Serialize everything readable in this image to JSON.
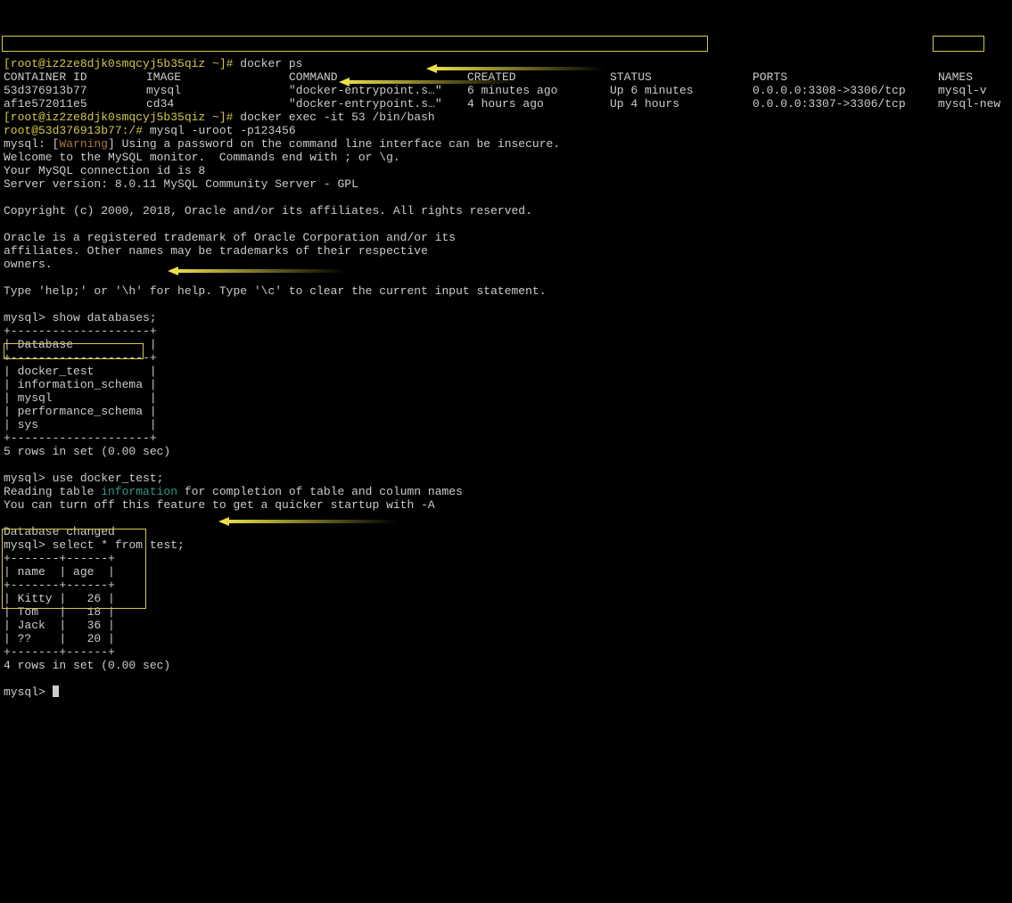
{
  "prompt_host": "[root@iz2ze8djk0smqcyj5b35qiz ~]#",
  "cmd_ps": "docker ps",
  "ps_header": {
    "id": "CONTAINER ID",
    "image": "IMAGE",
    "command": "COMMAND",
    "created": "CREATED",
    "status": "STATUS",
    "ports": "PORTS",
    "names": "NAMES"
  },
  "ps_rows": [
    {
      "id": "53d376913b77",
      "image": "mysql",
      "command": "\"docker-entrypoint.s…\"",
      "created": "6 minutes ago",
      "status": "Up 6 minutes",
      "ports": "0.0.0.0:3308->3306/tcp",
      "names": "mysql-v"
    },
    {
      "id": "af1e572011e5",
      "image": "cd34",
      "command": "\"docker-entrypoint.s…\"",
      "created": "4 hours ago",
      "status": "Up 4 hours",
      "ports": "0.0.0.0:3307->3306/tcp",
      "names": "mysql-new"
    }
  ],
  "cmd_exec": "docker exec -it 53 /bin/bash",
  "prompt_container": "root@53d376913b77:/#",
  "cmd_mysql_login": "mysql -uroot -p123456",
  "warn_prefix": "mysql: [",
  "warn_word": "Warning",
  "warn_suffix": "] Using a password on the command line interface can be insecure.",
  "welcome1": "Welcome to the MySQL monitor.  Commands end with ; or \\g.",
  "welcome2": "Your MySQL connection id is 8",
  "welcome3": "Server version: 8.0.11 MySQL Community Server - GPL",
  "copyright": "Copyright (c) 2000, 2018, Oracle and/or its affiliates. All rights reserved.",
  "oracle1": "Oracle is a registered trademark of Oracle Corporation and/or its",
  "oracle2": "affiliates. Other names may be trademarks of their respective",
  "oracle3": "owners.",
  "help": "Type 'help;' or '\\h' for help. Type '\\c' to clear the current input statement.",
  "mysql_prompt": "mysql>",
  "cmd_showdb": "show databases;",
  "db_border": "+--------------------+",
  "db_header": "| Database           |",
  "db_rows": [
    "| docker_test        |",
    "| information_schema |",
    "| mysql              |",
    "| performance_schema |",
    "| sys                |"
  ],
  "db_rows_count": "5 rows in set (0.00 sec)",
  "cmd_usedb": "use docker_test;",
  "reading1a": "Reading table ",
  "reading1b": "information",
  "reading1c": " for completion of table and column names",
  "reading2": "You can turn off this feature to get a quicker startup with -A",
  "db_changed": "Database changed",
  "cmd_select": "select * from test;",
  "test_border": "+-------+------+",
  "test_header": "| name  | age  |",
  "test_rows": [
    "| Kitty |   26 |",
    "| Tom   |   18 |",
    "| Jack  |   36 |",
    "| ??    |   20 |"
  ],
  "test_rows_count": "4 rows in set (0.00 sec)"
}
